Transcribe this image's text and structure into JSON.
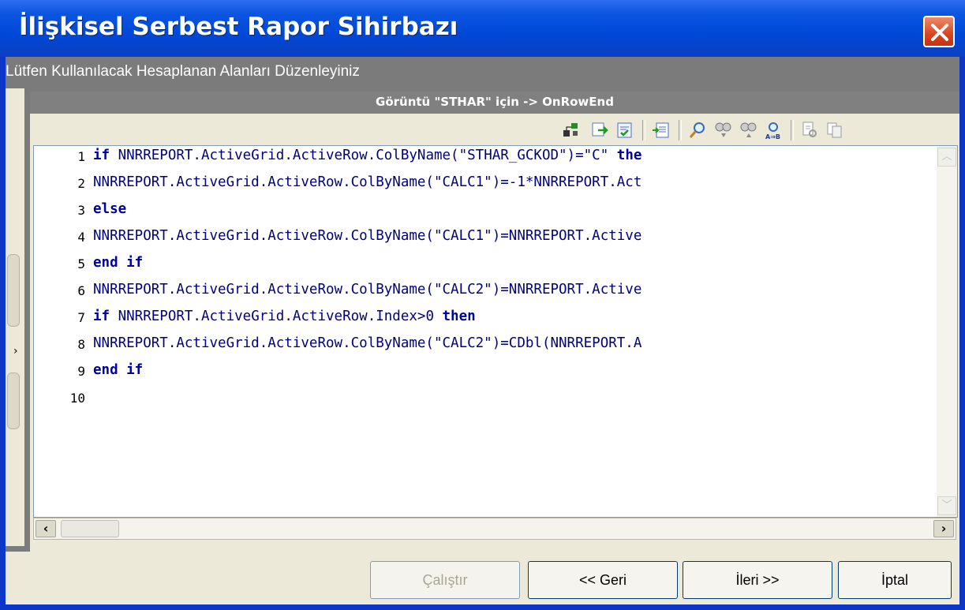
{
  "window": {
    "title": "İlişkisel Serbest Rapor Sihirbazı",
    "close_label": "Close"
  },
  "header": {
    "instruction": "Lütfen Kullanılacak Hesaplanan Alanları Düzenleyiniz"
  },
  "panel": {
    "title": "Görüntü \"STHAR\" için -> OnRowEnd"
  },
  "toolbar": {
    "icons": [
      "tree-view-icon",
      "load-script-icon",
      "check-syntax-icon",
      "insert-code-icon",
      "find-icon",
      "find-prev-icon",
      "find-next-icon",
      "replace-icon",
      "print-icon",
      "copy-icon"
    ]
  },
  "editor": {
    "lines": [
      {
        "num": "1",
        "code": "if NNRREPORT.ActiveGrid.ActiveRow.ColByName(\"STHAR_GCKOD\")=\"C\" then"
      },
      {
        "num": "2",
        "code": "NNRREPORT.ActiveGrid.ActiveRow.ColByName(\"CALC1\")=-1*NNRREPORT.Act"
      },
      {
        "num": "3",
        "code": "else"
      },
      {
        "num": "4",
        "code": "NNRREPORT.ActiveGrid.ActiveRow.ColByName(\"CALC1\")=NNRREPORT.Active"
      },
      {
        "num": "5",
        "code": "end if"
      },
      {
        "num": "6",
        "code": "NNRREPORT.ActiveGrid.ActiveRow.ColByName(\"CALC2\")=NNRREPORT.Active"
      },
      {
        "num": "7",
        "code": "if NNRREPORT.ActiveGrid.ActiveRow.Index>0 then"
      },
      {
        "num": "8",
        "code": "NNRREPORT.ActiveGrid.ActiveRow.ColByName(\"CALC2\")=CDbl(NNRREPORT.A"
      },
      {
        "num": "9",
        "code": "end if"
      },
      {
        "num": "10",
        "code": ""
      }
    ]
  },
  "buttons": {
    "run": "Çalıştır",
    "back": "<< Geri",
    "next": "İleri >>",
    "cancel": "İptal"
  },
  "colors": {
    "titlebar": "#0054e3",
    "close": "#d8431f",
    "client": "#7b7b7b",
    "panel": "#ece9d8",
    "code": "#00007f"
  }
}
